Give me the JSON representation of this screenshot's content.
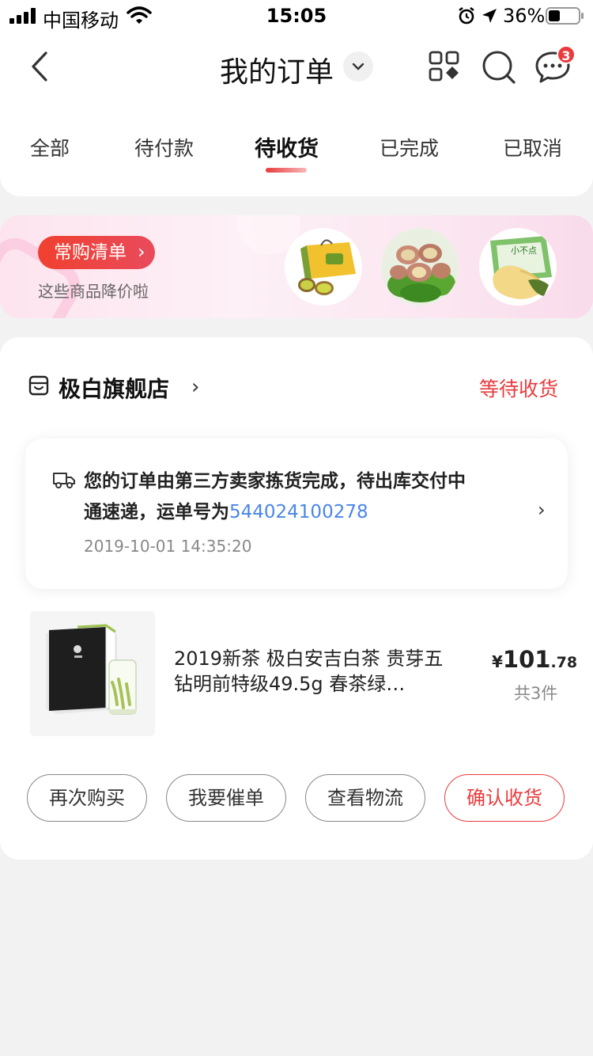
{
  "status_bar": {
    "carrier": "中国移动",
    "time": "15:05",
    "battery": "36%"
  },
  "header": {
    "title": "我的订单",
    "message_badge": "3"
  },
  "tabs": [
    {
      "label": "全部",
      "active": false
    },
    {
      "label": "待付款",
      "active": false
    },
    {
      "label": "待收货",
      "active": true
    },
    {
      "label": "已完成",
      "active": false
    },
    {
      "label": "已取消",
      "active": false
    }
  ],
  "banner": {
    "pill_label": "常购清单",
    "subtitle": "这些商品降价啦",
    "thumbnails": [
      "kiwi-gift-box",
      "scallops-on-lettuce",
      "durian-box"
    ],
    "thumbnail_box_text": "小不点"
  },
  "order": {
    "store_name": "极白旗舰店",
    "status": "等待收货",
    "logistics": {
      "message_line1": "您的订单由第三方卖家拣货完成，待出库交付中",
      "message_line2_prefix": "通速递，运单号为",
      "tracking_number": "544024100278",
      "time": "2019-10-01 14:35:20"
    },
    "product": {
      "title": "2019新茶 极白安吉白茶 贵芽五钻明前特级49.5g 春茶绿…",
      "price_symbol": "¥",
      "price_integer": "101",
      "price_decimal": ".78",
      "quantity": "共3件"
    },
    "actions": [
      {
        "label": "再次购买"
      },
      {
        "label": "我要催单"
      },
      {
        "label": "查看物流"
      },
      {
        "label": "确认收货",
        "primary": true
      }
    ]
  },
  "colors": {
    "accent": "#e93b3d",
    "link": "#4a86e8",
    "background": "#f2f2f2"
  }
}
